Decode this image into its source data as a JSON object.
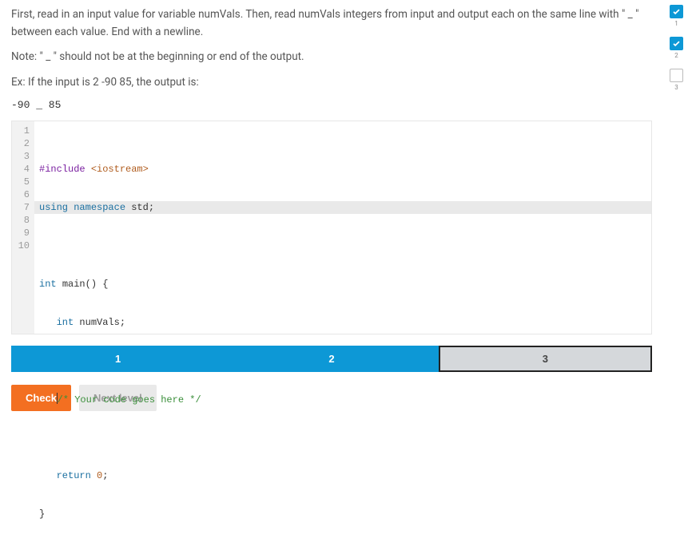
{
  "prompt": {
    "p1": "First, read in an input value for variable numVals. Then, read numVals integers from input and output each on the same line with \" _ \" between each value. End with a newline.",
    "p2": "Note: \" _ \" should not be at the beginning or end of the output.",
    "p3": "Ex: If the input is 2 -90 85, the output is:",
    "sample": "-90 _ 85"
  },
  "code": {
    "lines": [
      "1",
      "2",
      "3",
      "4",
      "5",
      "6",
      "7",
      "8",
      "9",
      "10"
    ],
    "l1_a": "#include ",
    "l1_b": "<iostream>",
    "l2_a": "using ",
    "l2_b": "namespace ",
    "l2_c": "std;",
    "l3": "",
    "l4_a": "int ",
    "l4_b": "main() {",
    "l5_a": "int ",
    "l5_b": "numVals;",
    "l6": "",
    "l7": "/* Your code goes here */",
    "l8": "",
    "l9_a": "return ",
    "l9_b": "0",
    "l9_c": ";",
    "l10": "}"
  },
  "levels": {
    "t1": "1",
    "t2": "2",
    "t3": "3"
  },
  "buttons": {
    "check": "Check",
    "next": "Next level"
  },
  "side": {
    "n1": "1",
    "n2": "2",
    "n3": "3"
  }
}
